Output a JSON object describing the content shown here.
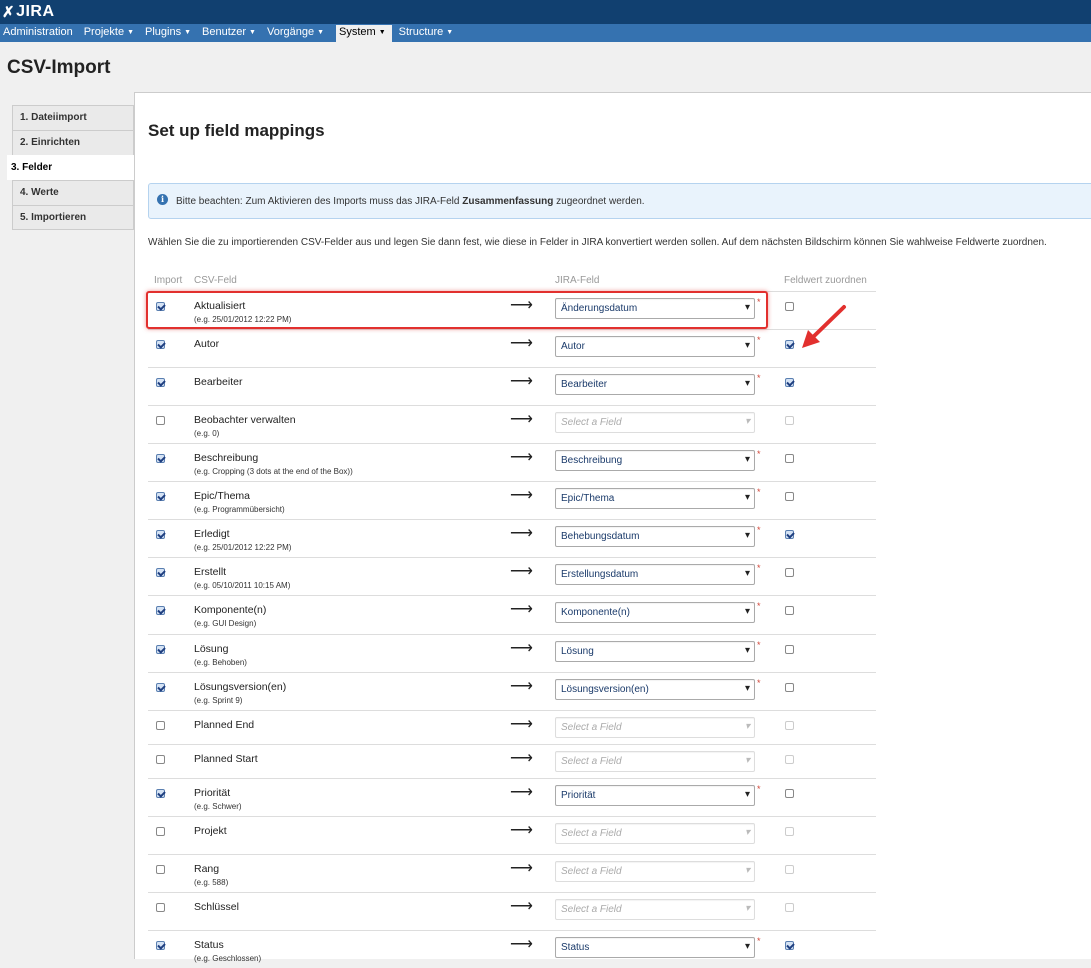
{
  "header": {
    "logo_text": "JIRA",
    "logo_icon": "jira-x-icon"
  },
  "nav": [
    {
      "label": "Administration",
      "caret": false,
      "active": false
    },
    {
      "label": "Projekte",
      "caret": true,
      "active": false
    },
    {
      "label": "Plugins",
      "caret": true,
      "active": false
    },
    {
      "label": "Benutzer",
      "caret": true,
      "active": false
    },
    {
      "label": "Vorgänge",
      "caret": true,
      "active": false
    },
    {
      "label": "System",
      "caret": true,
      "active": true
    },
    {
      "label": "Structure",
      "caret": true,
      "active": false
    }
  ],
  "page_title": "CSV-Import",
  "steps": [
    {
      "label": "1. Dateiimport",
      "active": false
    },
    {
      "label": "2. Einrichten",
      "active": false
    },
    {
      "label": "3. Felder",
      "active": true
    },
    {
      "label": "4. Werte",
      "active": false
    },
    {
      "label": "5. Importieren",
      "active": false
    }
  ],
  "panel": {
    "heading": "Set up field mappings",
    "info_before": "Bitte beachten: Zum Aktivieren des Imports muss das JIRA-Feld ",
    "info_bold": "Zusammenfassung",
    "info_after": " zugeordnet werden.",
    "intro": "Wählen Sie die zu importierenden CSV-Felder aus und legen Sie dann fest, wie diese in Felder in JIRA konvertiert werden sollen. Auf dem nächsten Bildschirm können Sie wahlweise Feldwerte zuordnen."
  },
  "columns": {
    "import": "Import",
    "csv_field": "CSV-Feld",
    "jira_field": "JIRA-Feld",
    "map_values": "Feldwert zuordnen"
  },
  "arrow_symbol": "⟶",
  "required_marker": "*",
  "rows": [
    {
      "name": "Aktualisiert",
      "example": "(e.g. 25/01/2012 12:22 PM)",
      "import": true,
      "jira": "Änderungsdatum",
      "empty": false,
      "required": true,
      "map": false,
      "map_disabled": false,
      "height": 38
    },
    {
      "name": "Autor",
      "example": "",
      "import": true,
      "jira": "Autor",
      "empty": false,
      "required": true,
      "map": true,
      "map_disabled": false,
      "height": 38
    },
    {
      "name": "Bearbeiter",
      "example": "",
      "import": true,
      "jira": "Bearbeiter",
      "empty": false,
      "required": true,
      "map": true,
      "map_disabled": false,
      "height": 38
    },
    {
      "name": "Beobachter verwalten",
      "example": "(e.g. 0)",
      "import": false,
      "jira": "Select a Field",
      "empty": true,
      "required": false,
      "map": false,
      "map_disabled": true,
      "height": 38
    },
    {
      "name": "Beschreibung",
      "example": "(e.g. Cropping (3 dots at the end of the Box))",
      "import": true,
      "jira": "Beschreibung",
      "empty": false,
      "required": true,
      "map": false,
      "map_disabled": false,
      "height": 38
    },
    {
      "name": "Epic/Thema",
      "example": "(e.g. Programmübersicht)",
      "import": true,
      "jira": "Epic/Thema",
      "empty": false,
      "required": true,
      "map": false,
      "map_disabled": false,
      "height": 38
    },
    {
      "name": "Erledigt",
      "example": "(e.g. 25/01/2012 12:22 PM)",
      "import": true,
      "jira": "Behebungsdatum",
      "empty": false,
      "required": true,
      "map": true,
      "map_disabled": false,
      "height": 38
    },
    {
      "name": "Erstellt",
      "example": "(e.g. 05/10/2011 10:15 AM)",
      "import": true,
      "jira": "Erstellungsdatum",
      "empty": false,
      "required": true,
      "map": false,
      "map_disabled": false,
      "height": 38
    },
    {
      "name": "Komponente(n)",
      "example": "(e.g. GUI Design)",
      "import": true,
      "jira": "Komponente(n)",
      "empty": false,
      "required": true,
      "map": false,
      "map_disabled": false,
      "height": 39
    },
    {
      "name": "Lösung",
      "example": "(e.g. Behoben)",
      "import": true,
      "jira": "Lösung",
      "empty": false,
      "required": true,
      "map": false,
      "map_disabled": false,
      "height": 38
    },
    {
      "name": "Lösungsversion(en)",
      "example": "(e.g. Sprint 9)",
      "import": true,
      "jira": "Lösungsversion(en)",
      "empty": false,
      "required": true,
      "map": false,
      "map_disabled": false,
      "height": 38
    },
    {
      "name": "Planned End",
      "example": "",
      "import": false,
      "jira": "Select a Field",
      "empty": true,
      "required": false,
      "map": false,
      "map_disabled": true,
      "height": 34
    },
    {
      "name": "Planned Start",
      "example": "",
      "import": false,
      "jira": "Select a Field",
      "empty": true,
      "required": false,
      "map": false,
      "map_disabled": true,
      "height": 34
    },
    {
      "name": "Priorität",
      "example": "(e.g. Schwer)",
      "import": true,
      "jira": "Priorität",
      "empty": false,
      "required": true,
      "map": false,
      "map_disabled": false,
      "height": 38
    },
    {
      "name": "Projekt",
      "example": "",
      "import": false,
      "jira": "Select a Field",
      "empty": true,
      "required": false,
      "map": false,
      "map_disabled": true,
      "height": 38
    },
    {
      "name": "Rang",
      "example": "(e.g. 588)",
      "import": false,
      "jira": "Select a Field",
      "empty": true,
      "required": false,
      "map": false,
      "map_disabled": true,
      "height": 38
    },
    {
      "name": "Schlüssel",
      "example": "",
      "import": false,
      "jira": "Select a Field",
      "empty": true,
      "required": false,
      "map": false,
      "map_disabled": true,
      "height": 38
    },
    {
      "name": "Status",
      "example": "(e.g. Geschlossen)",
      "import": true,
      "jira": "Status",
      "empty": false,
      "required": true,
      "map": true,
      "map_disabled": false,
      "height": 38
    }
  ],
  "colors": {
    "topbar": "#114070",
    "navbar": "#3572b0",
    "highlight": "#e2302e",
    "required": "#d04437"
  }
}
